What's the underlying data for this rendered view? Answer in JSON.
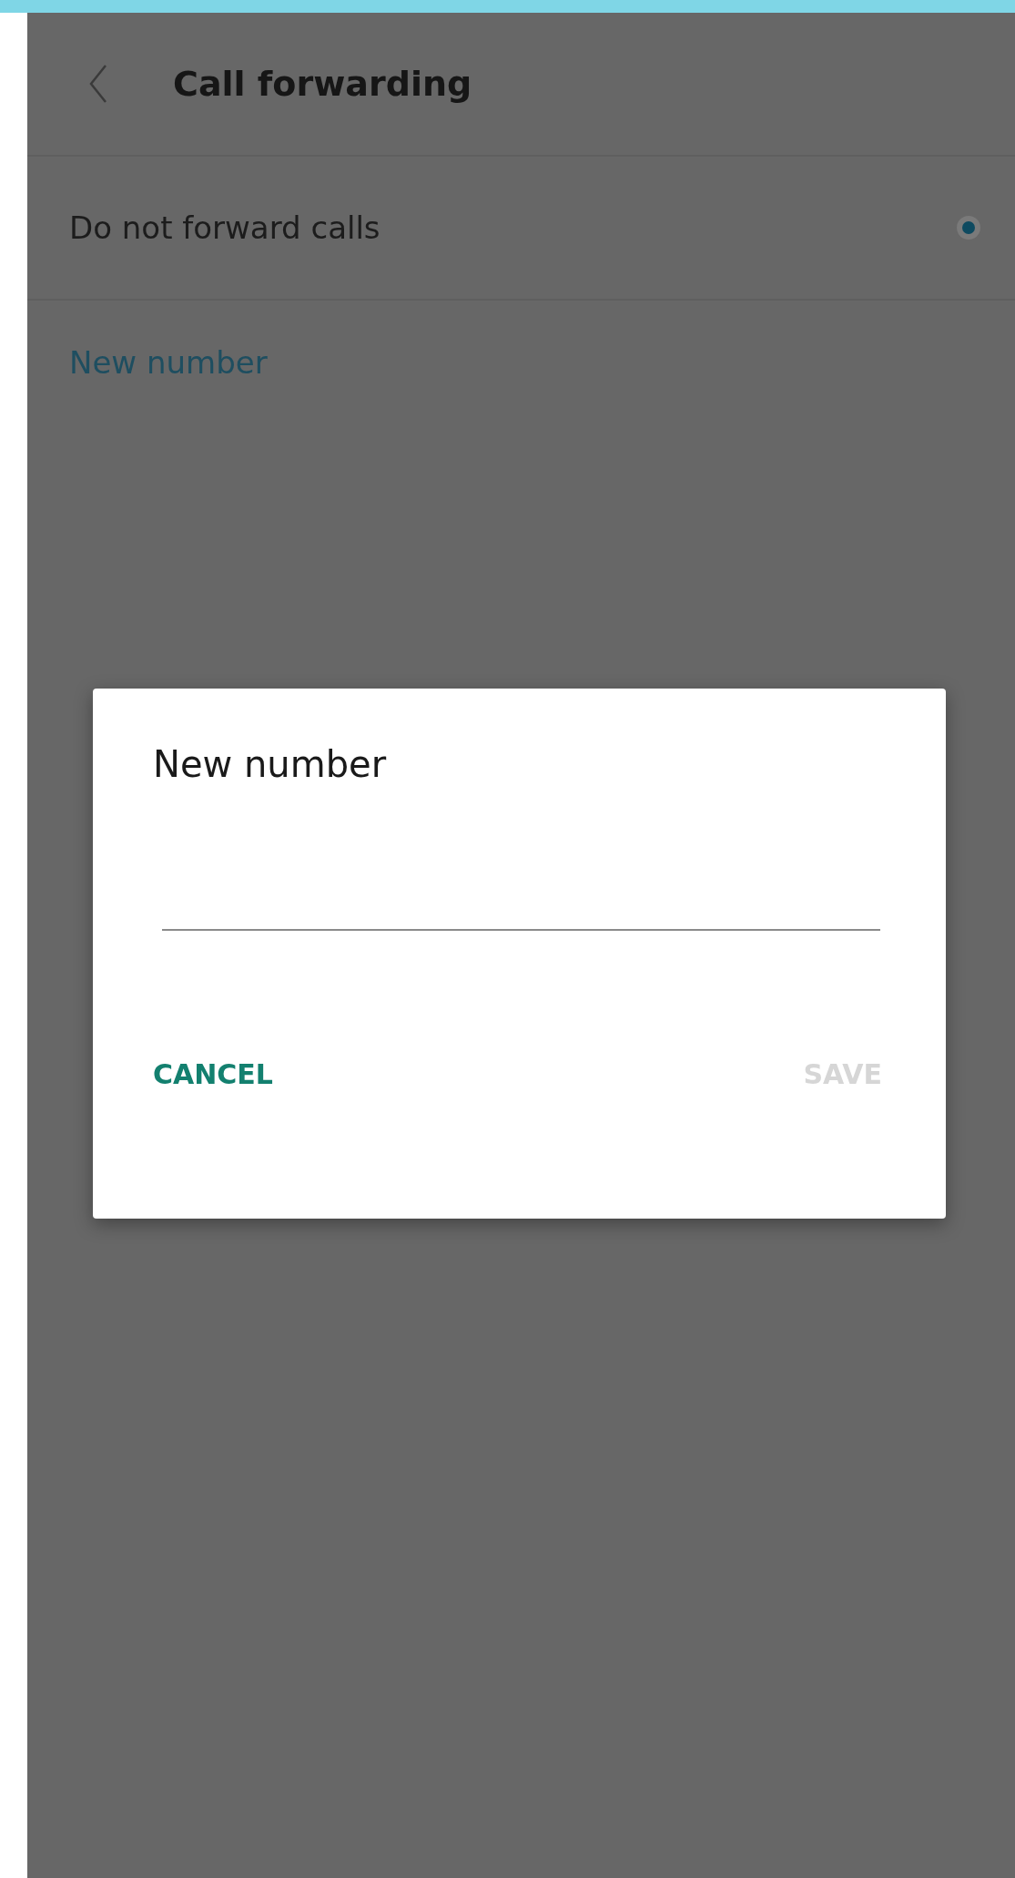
{
  "header": {
    "title": "Call forwarding"
  },
  "options": [
    {
      "kind": "radio",
      "label": "Do not forward calls",
      "selected": true
    },
    {
      "kind": "link",
      "label": "New number"
    }
  ],
  "dialog": {
    "title": "New number",
    "input": {
      "focused": false
    },
    "buttons": [
      {
        "label": "CANCEL",
        "disabled": false
      },
      {
        "label": "SAVE",
        "disabled": true
      }
    ]
  }
}
